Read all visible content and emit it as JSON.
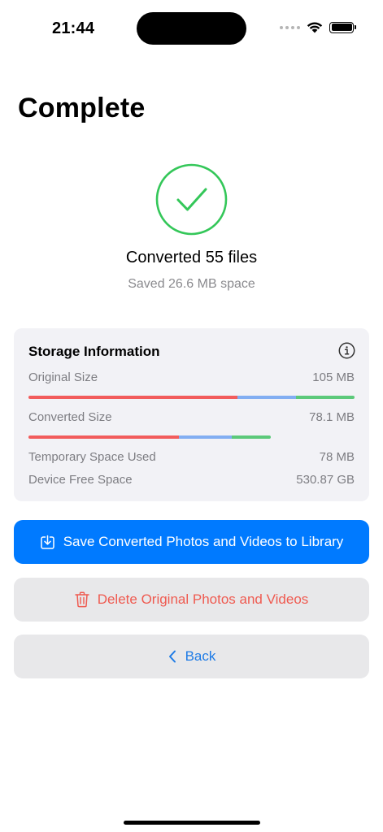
{
  "status_bar": {
    "time": "21:44",
    "icons": [
      "signal-dots-icon",
      "wifi-icon",
      "battery-icon"
    ]
  },
  "page": {
    "title": "Complete"
  },
  "summary": {
    "icon": "checkmark-circle-icon",
    "converted_label": "Converted 55 files",
    "saved_label": "Saved 26.6 MB space",
    "accent_color": "#34c759"
  },
  "storage": {
    "title": "Storage Information",
    "info_icon": "info-icon",
    "rows": {
      "original": {
        "label": "Original Size",
        "value": "105 MB"
      },
      "converted": {
        "label": "Converted Size",
        "value": "78.1 MB"
      },
      "temporary": {
        "label": "Temporary Space Used",
        "value": "78 MB"
      },
      "free": {
        "label": "Device Free Space",
        "value": "530.87 GB"
      }
    },
    "bars": {
      "original": {
        "fill_fraction": 1.0,
        "segments": [
          {
            "color": "#f25c5c",
            "fraction": 0.64
          },
          {
            "color": "#82aef2",
            "fraction": 0.18
          },
          {
            "color": "#5cc97a",
            "fraction": 0.18
          }
        ]
      },
      "converted": {
        "fill_fraction": 0.744,
        "segments": [
          {
            "color": "#f25c5c",
            "fraction": 0.62
          },
          {
            "color": "#82aef2",
            "fraction": 0.22
          },
          {
            "color": "#5cc97a",
            "fraction": 0.16
          }
        ]
      }
    }
  },
  "actions": {
    "save_label": "Save Converted Photos and Videos to Library",
    "save_icon": "save-to-library-icon",
    "delete_label": "Delete Original Photos and Videos",
    "delete_icon": "trash-icon",
    "back_label": "Back",
    "back_icon": "chevron-left-icon"
  },
  "colors": {
    "primary": "#007aff",
    "danger": "#ef5a50",
    "success": "#34c759",
    "secondary_text": "#8a8a8e"
  }
}
